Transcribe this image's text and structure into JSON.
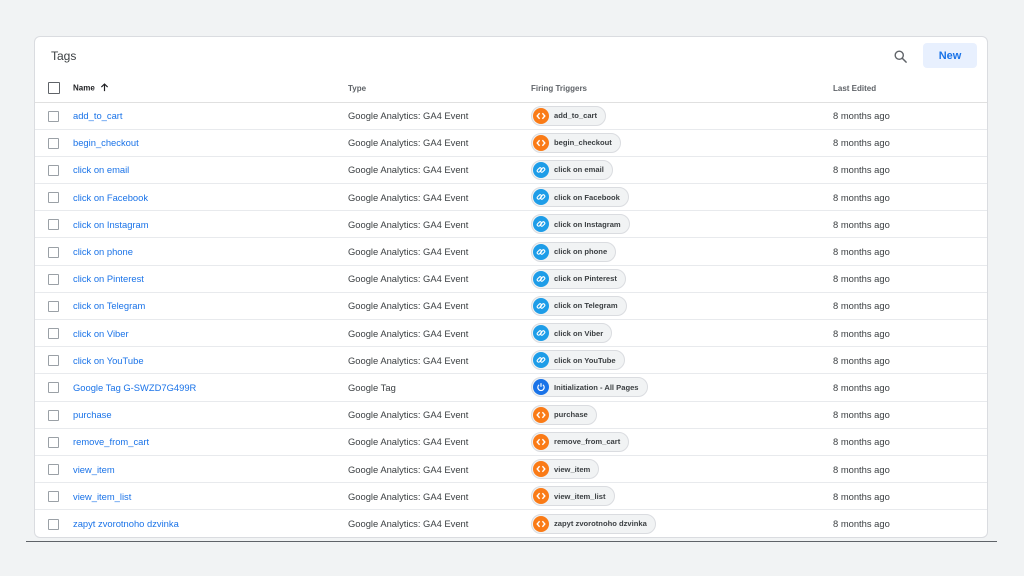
{
  "card": {
    "title": "Tags",
    "new_button": "New"
  },
  "columns": {
    "name": "Name",
    "type": "Type",
    "triggers": "Firing Triggers",
    "edited": "Last Edited"
  },
  "colors": {
    "accent": "#1a73e8",
    "custom_event_trigger": "#fa7b17",
    "click_trigger": "#1e9de8",
    "pageview_trigger": "#1a73e8"
  },
  "rows": [
    {
      "name": "add_to_cart",
      "type": "Google Analytics: GA4 Event",
      "trigger": "add_to_cart",
      "trigger_icon": "custom-event",
      "edited": "8 months ago"
    },
    {
      "name": "begin_checkout",
      "type": "Google Analytics: GA4 Event",
      "trigger": "begin_checkout",
      "trigger_icon": "custom-event",
      "edited": "8 months ago"
    },
    {
      "name": "click on email",
      "type": "Google Analytics: GA4 Event",
      "trigger": "click on email",
      "trigger_icon": "link-click",
      "edited": "8 months ago"
    },
    {
      "name": "click on Facebook",
      "type": "Google Analytics: GA4 Event",
      "trigger": "click on Facebook",
      "trigger_icon": "link-click",
      "edited": "8 months ago"
    },
    {
      "name": "click on Instagram",
      "type": "Google Analytics: GA4 Event",
      "trigger": "click on Instagram",
      "trigger_icon": "link-click",
      "edited": "8 months ago"
    },
    {
      "name": "click on phone",
      "type": "Google Analytics: GA4 Event",
      "trigger": "click on phone",
      "trigger_icon": "link-click",
      "edited": "8 months ago"
    },
    {
      "name": "click on Pinterest",
      "type": "Google Analytics: GA4 Event",
      "trigger": "click on Pinterest",
      "trigger_icon": "link-click",
      "edited": "8 months ago"
    },
    {
      "name": "click on Telegram",
      "type": "Google Analytics: GA4 Event",
      "trigger": "click on Telegram",
      "trigger_icon": "link-click",
      "edited": "8 months ago"
    },
    {
      "name": "click on Viber",
      "type": "Google Analytics: GA4 Event",
      "trigger": "click on Viber",
      "trigger_icon": "link-click",
      "edited": "8 months ago"
    },
    {
      "name": "click on YouTube",
      "type": "Google Analytics: GA4 Event",
      "trigger": "click on YouTube",
      "trigger_icon": "link-click",
      "edited": "8 months ago"
    },
    {
      "name": "Google Tag G-SWZD7G499R",
      "type": "Google Tag",
      "trigger": "Initialization - All Pages",
      "trigger_icon": "power",
      "edited": "8 months ago"
    },
    {
      "name": "purchase",
      "type": "Google Analytics: GA4 Event",
      "trigger": "purchase",
      "trigger_icon": "custom-event",
      "edited": "8 months ago"
    },
    {
      "name": "remove_from_cart",
      "type": "Google Analytics: GA4 Event",
      "trigger": "remove_from_cart",
      "trigger_icon": "custom-event",
      "edited": "8 months ago"
    },
    {
      "name": "view_item",
      "type": "Google Analytics: GA4 Event",
      "trigger": "view_item",
      "trigger_icon": "custom-event",
      "edited": "8 months ago"
    },
    {
      "name": "view_item_list",
      "type": "Google Analytics: GA4 Event",
      "trigger": "view_item_list",
      "trigger_icon": "custom-event",
      "edited": "8 months ago"
    },
    {
      "name": "zapyt zvorotnoho dzvinka",
      "type": "Google Analytics: GA4 Event",
      "trigger": "zapyt zvorotnoho dzvinka",
      "trigger_icon": "custom-event",
      "edited": "8 months ago"
    }
  ]
}
